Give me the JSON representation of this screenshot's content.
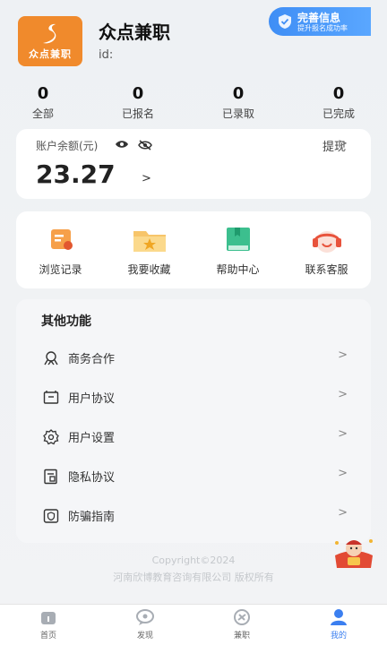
{
  "profile": {
    "logo_text": "众点兼职",
    "app_name": "众点兼职",
    "id_label": "id:"
  },
  "complete_info": {
    "title": "完善信息",
    "subtitle": "提升报名成功率"
  },
  "stats": [
    {
      "value": "0",
      "label": "全部"
    },
    {
      "value": "0",
      "label": "已报名"
    },
    {
      "value": "0",
      "label": "已录取"
    },
    {
      "value": "0",
      "label": "已完成"
    }
  ],
  "balance": {
    "label": "账户余额(元)",
    "amount": "23.27",
    "withdraw_label": "提现"
  },
  "quick_actions": [
    {
      "label": "浏览记录",
      "icon": "browse-history-icon"
    },
    {
      "label": "我要收藏",
      "icon": "favorites-folder-icon"
    },
    {
      "label": "帮助中心",
      "icon": "help-book-icon"
    },
    {
      "label": "联系客服",
      "icon": "headset-icon"
    }
  ],
  "other_functions": {
    "title": "其他功能",
    "items": [
      {
        "label": "商务合作",
        "icon": "handshake-icon"
      },
      {
        "label": "用户协议",
        "icon": "agreement-icon"
      },
      {
        "label": "用户设置",
        "icon": "gear-icon"
      },
      {
        "label": "隐私协议",
        "icon": "privacy-icon"
      },
      {
        "label": "防骗指南",
        "icon": "shield-guide-icon"
      }
    ]
  },
  "copyright": {
    "line1": "Copyright©2024",
    "line2": "河南欣博教育咨询有限公司 版权所有"
  },
  "tabbar": [
    {
      "label": "首页",
      "icon": "home-icon"
    },
    {
      "label": "发现",
      "icon": "discover-icon"
    },
    {
      "label": "兼职",
      "icon": "parttime-icon"
    },
    {
      "label": "我的",
      "icon": "profile-icon"
    }
  ],
  "colors": {
    "accent": "#3b7ff0",
    "logo": "#f08a2c"
  }
}
